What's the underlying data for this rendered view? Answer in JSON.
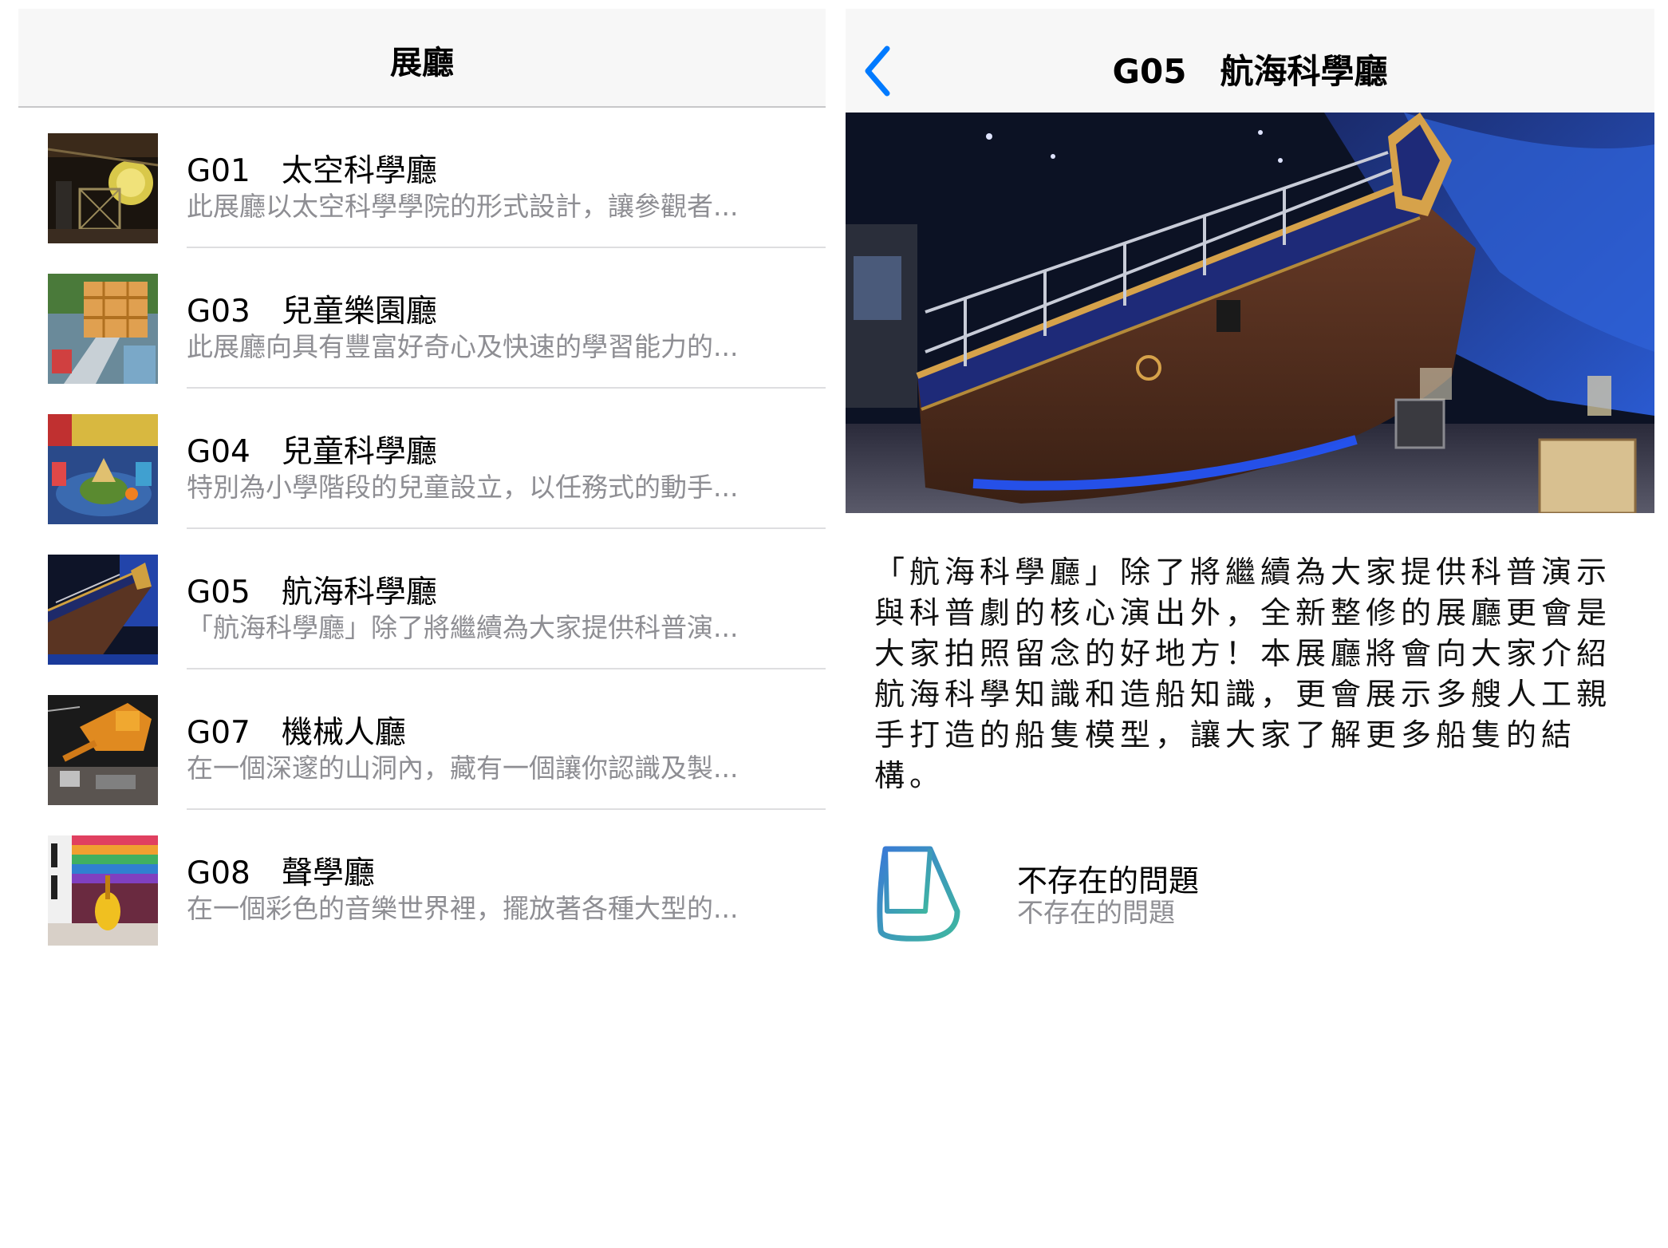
{
  "list_screen": {
    "nav_title": "展廳",
    "halls": [
      {
        "code": "G01",
        "name": "太空科學廳",
        "title": "G01　太空科學廳",
        "description": "此展廳以太空科學學院的形式設計，讓參觀者..."
      },
      {
        "code": "G03",
        "name": "兒童樂園廳",
        "title": "G03　兒童樂園廳",
        "description": "此展廳向具有豐富好奇心及快速的學習能力的..."
      },
      {
        "code": "G04",
        "name": "兒童科學廳",
        "title": "G04　兒童科學廳",
        "description": "特別為小學階段的兒童設立，以任務式的動手..."
      },
      {
        "code": "G05",
        "name": "航海科學廳",
        "title": "G05　航海科學廳",
        "description": "「航海科學廳」除了將繼續為大家提供科普演..."
      },
      {
        "code": "G07",
        "name": "機械人廳",
        "title": "G07　機械人廳",
        "description": "在一個深邃的山洞內，藏有一個讓你認識及製..."
      },
      {
        "code": "G08",
        "name": "聲學廳",
        "title": "G08　聲學廳",
        "description": "在一個彩色的音樂世界裡，擺放著各種大型的..."
      }
    ]
  },
  "detail_screen": {
    "title": "G05　航海科學廳",
    "back_icon": "chevron-left-icon",
    "description": "「航海科學廳」除了將繼續為大家提供科普演示與科普劇的核心演出外，全新整修的展廳更會是大家拍照留念的好地方！本展廳將會向大家介紹航海科學知識和造船知識，更會展示多艘人工親手打造的船隻模型，讓大家了解更多船隻的結構。",
    "related": {
      "icon": "sail-icon",
      "title": "不存在的問題",
      "subtitle": "不存在的問題"
    }
  },
  "colors": {
    "nav_background": "#f7f7f7",
    "accent_blue": "#007aff",
    "secondary_text": "#8e8e93",
    "separator": "#dedee0",
    "sail_icon_gradient": [
      "#3a7bd5",
      "#3fb7a0"
    ]
  }
}
